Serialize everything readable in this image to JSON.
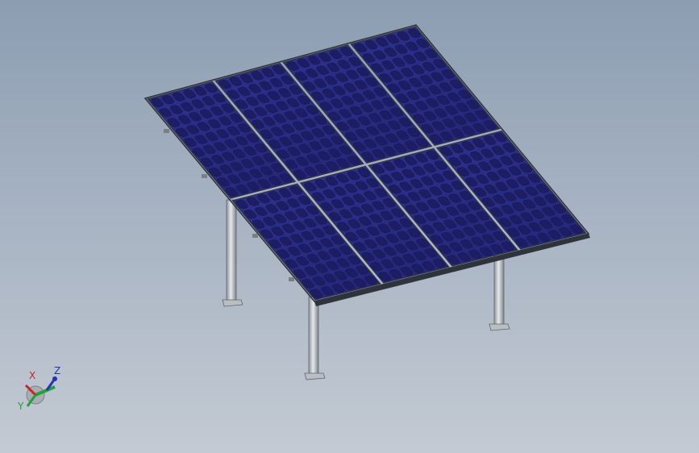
{
  "triad": {
    "x_label": "X",
    "y_label": "Y",
    "z_label": "Z"
  },
  "colors": {
    "background_top": "#8c9db2",
    "background_bottom": "#c3cad3",
    "panel_fill": "#2a2d88",
    "cell_fill": "#1c1d63",
    "frame": "#2f333c",
    "post": "#c2c7cd",
    "axis_x": "#c8232a",
    "axis_y": "#23a23a",
    "axis_z": "#2334b0"
  }
}
